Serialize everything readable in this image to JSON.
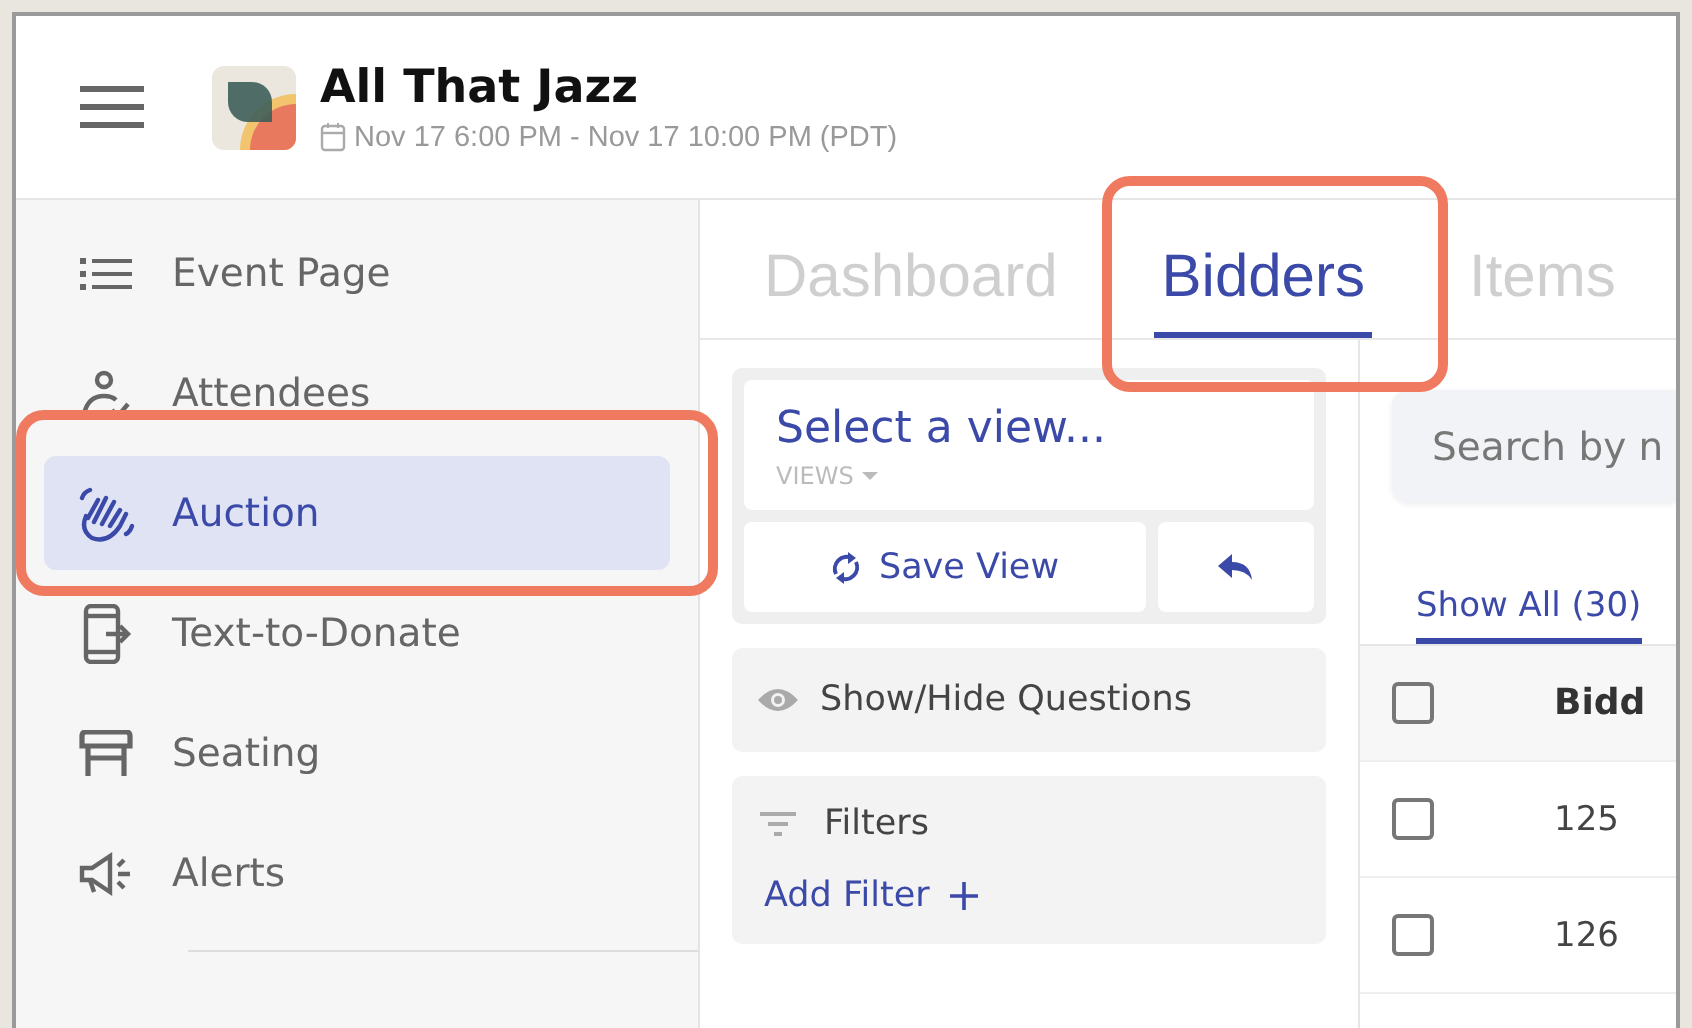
{
  "header": {
    "title": "All That Jazz",
    "date": "Nov 17 6:00 PM - Nov 17 10:00 PM (PDT)"
  },
  "sidebar": {
    "items": [
      {
        "label": "Event Page",
        "kind": "list",
        "selected": false
      },
      {
        "label": "Attendees",
        "kind": "people",
        "selected": false
      },
      {
        "label": "Auction",
        "kind": "hand",
        "selected": true
      },
      {
        "label": "Text-to-Donate",
        "kind": "phone",
        "selected": false
      },
      {
        "label": "Seating",
        "kind": "table",
        "selected": false
      },
      {
        "label": "Alerts",
        "kind": "megaphone",
        "selected": false
      }
    ]
  },
  "tabs": [
    {
      "label": "Dashboard",
      "selected": false
    },
    {
      "label": "Bidders",
      "selected": true
    },
    {
      "label": "Items",
      "selected": false
    }
  ],
  "view_panel": {
    "title": "Select a view...",
    "subtitle": "VIEWS",
    "save_button": "Save View"
  },
  "questions": {
    "label": "Show/Hide Questions"
  },
  "filters": {
    "title": "Filters",
    "add_button": "Add Filter"
  },
  "search": {
    "placeholder": "Search by n"
  },
  "filter_tabs": [
    {
      "label": "Show All (30)",
      "selected": true
    }
  ],
  "table": {
    "columns": [
      {
        "label": "Bidd",
        "checked": false
      }
    ],
    "rows": [
      {
        "cells": [
          "125"
        ],
        "checked": false
      },
      {
        "cells": [
          "126"
        ],
        "checked": false
      }
    ]
  }
}
